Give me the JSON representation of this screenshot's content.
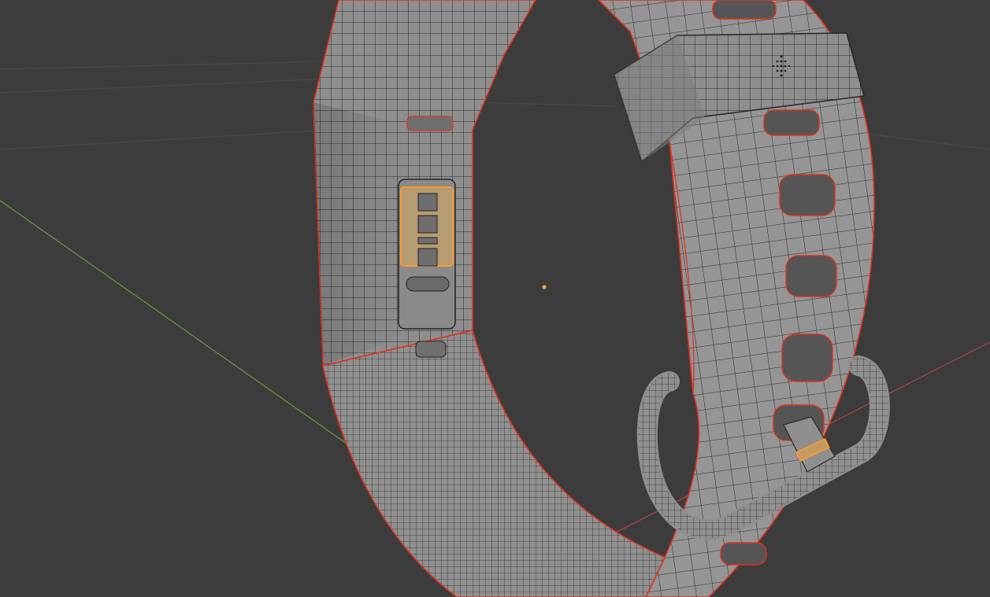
{
  "viewport": {
    "background_color": "#3c3c3c",
    "grid_color": "#4a4a4a",
    "x_axis_color": "#b34545",
    "y_axis_color": "#6f9a3a",
    "mesh_surface_color": "#8f8f8f",
    "mesh_wire_color": "#2a2a2a",
    "seam_color": "#e0301e",
    "selection_color": "#ff9a2e",
    "origin_dot_color": "#ffa033"
  },
  "model": {
    "description_icon": "watch-band-mesh-icon",
    "parts": [
      "band-loop",
      "tracker-back",
      "keeper-loop",
      "buckle",
      "strap-holes"
    ]
  }
}
